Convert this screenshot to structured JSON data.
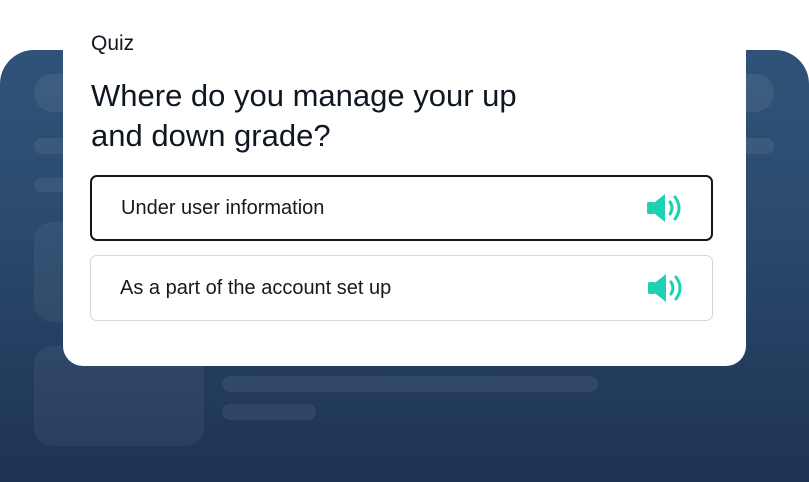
{
  "quiz": {
    "label": "Quiz",
    "question_line1": "Where do you manage your up",
    "question_line2": "and down grade?",
    "options": [
      {
        "label": "Under user information",
        "selected": true,
        "audio_icon": "speaker-icon"
      },
      {
        "label": "As a part of the account set up",
        "selected": false,
        "audio_icon": "speaker-icon"
      }
    ]
  },
  "colors": {
    "accent": "#1fd1b4",
    "background_app": "#2b4a6e",
    "card": "#ffffff",
    "text": "#0f1722",
    "selected_border": "#111820",
    "option_border": "#d3d8de"
  }
}
